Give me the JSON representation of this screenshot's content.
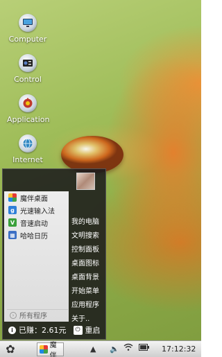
{
  "desktop": {
    "icons": [
      {
        "label": "Computer",
        "icon": "computer-icon"
      },
      {
        "label": "Control",
        "icon": "control-icon"
      },
      {
        "label": "Application",
        "icon": "application-icon"
      },
      {
        "label": "Internet",
        "icon": "internet-icon"
      }
    ]
  },
  "start_menu": {
    "apps": [
      {
        "label": "魔伴桌面",
        "icon": "mobanzhuomian-icon",
        "color": "#e0b030"
      },
      {
        "label": "光速输入法",
        "icon": "input-method-icon",
        "color": "#2f7fd8"
      },
      {
        "label": "音速启动",
        "icon": "yinsu-launch-icon",
        "color": "#3aa03a"
      },
      {
        "label": "哈哈日历",
        "icon": "calendar-icon",
        "color": "#3c6fc4"
      }
    ],
    "all_programs": "所有程序",
    "right_items": [
      "我的电脑",
      "文明搜索",
      "控制面板",
      "桌面图标",
      "桌面背景",
      "开始菜单",
      "应用程序",
      "关于.."
    ],
    "earned": "已赚：2.61元",
    "restart": "重启"
  },
  "taskbar": {
    "app_label": "魔伴",
    "clock": "17:12:32"
  }
}
